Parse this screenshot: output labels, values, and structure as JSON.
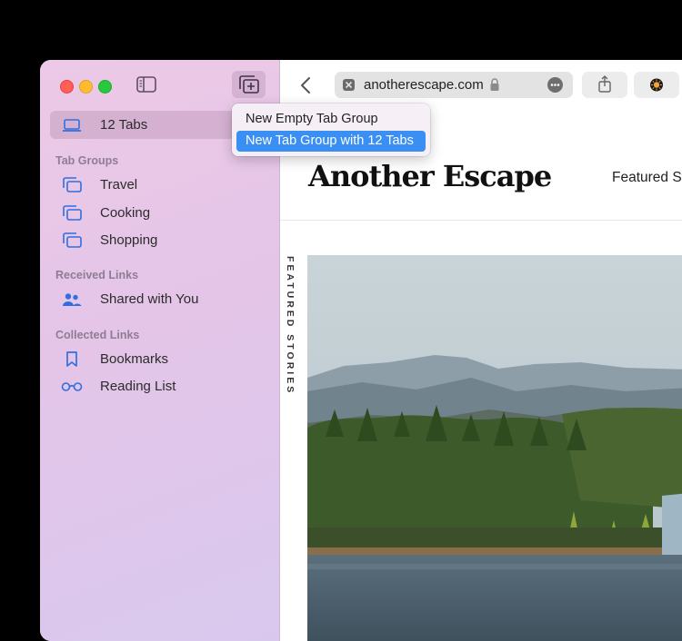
{
  "sidebar": {
    "current_tabs_label": "12 Tabs",
    "tab_groups_heading": "Tab Groups",
    "tab_groups": [
      {
        "label": "Travel"
      },
      {
        "label": "Cooking"
      },
      {
        "label": "Shopping"
      }
    ],
    "received_links_heading": "Received Links",
    "shared_with_you_label": "Shared with You",
    "collected_links_heading": "Collected Links",
    "bookmarks_label": "Bookmarks",
    "reading_list_label": "Reading List"
  },
  "new_group_menu": {
    "items": [
      {
        "label": "New Empty Tab Group"
      },
      {
        "label": "New Tab Group with 12 Tabs",
        "highlighted": true
      }
    ]
  },
  "toolbar": {
    "address": "anotherescape.com"
  },
  "site": {
    "logo": "Another Escape",
    "nav_featured": "Featured St",
    "side_caption": "FEATURED STORIES"
  },
  "colors": {
    "accent_blue": "#3a8ff5",
    "sidebar_icon_blue": "#2f6fe0"
  },
  "icons": {
    "sidebar_toggle": "sidebar-icon",
    "new_tab_group": "plus-square-icon",
    "laptop": "laptop-icon",
    "tab_group": "tabs-icon",
    "shared": "people-icon",
    "bookmark": "bookmark-icon",
    "reading_list": "glasses-icon"
  }
}
